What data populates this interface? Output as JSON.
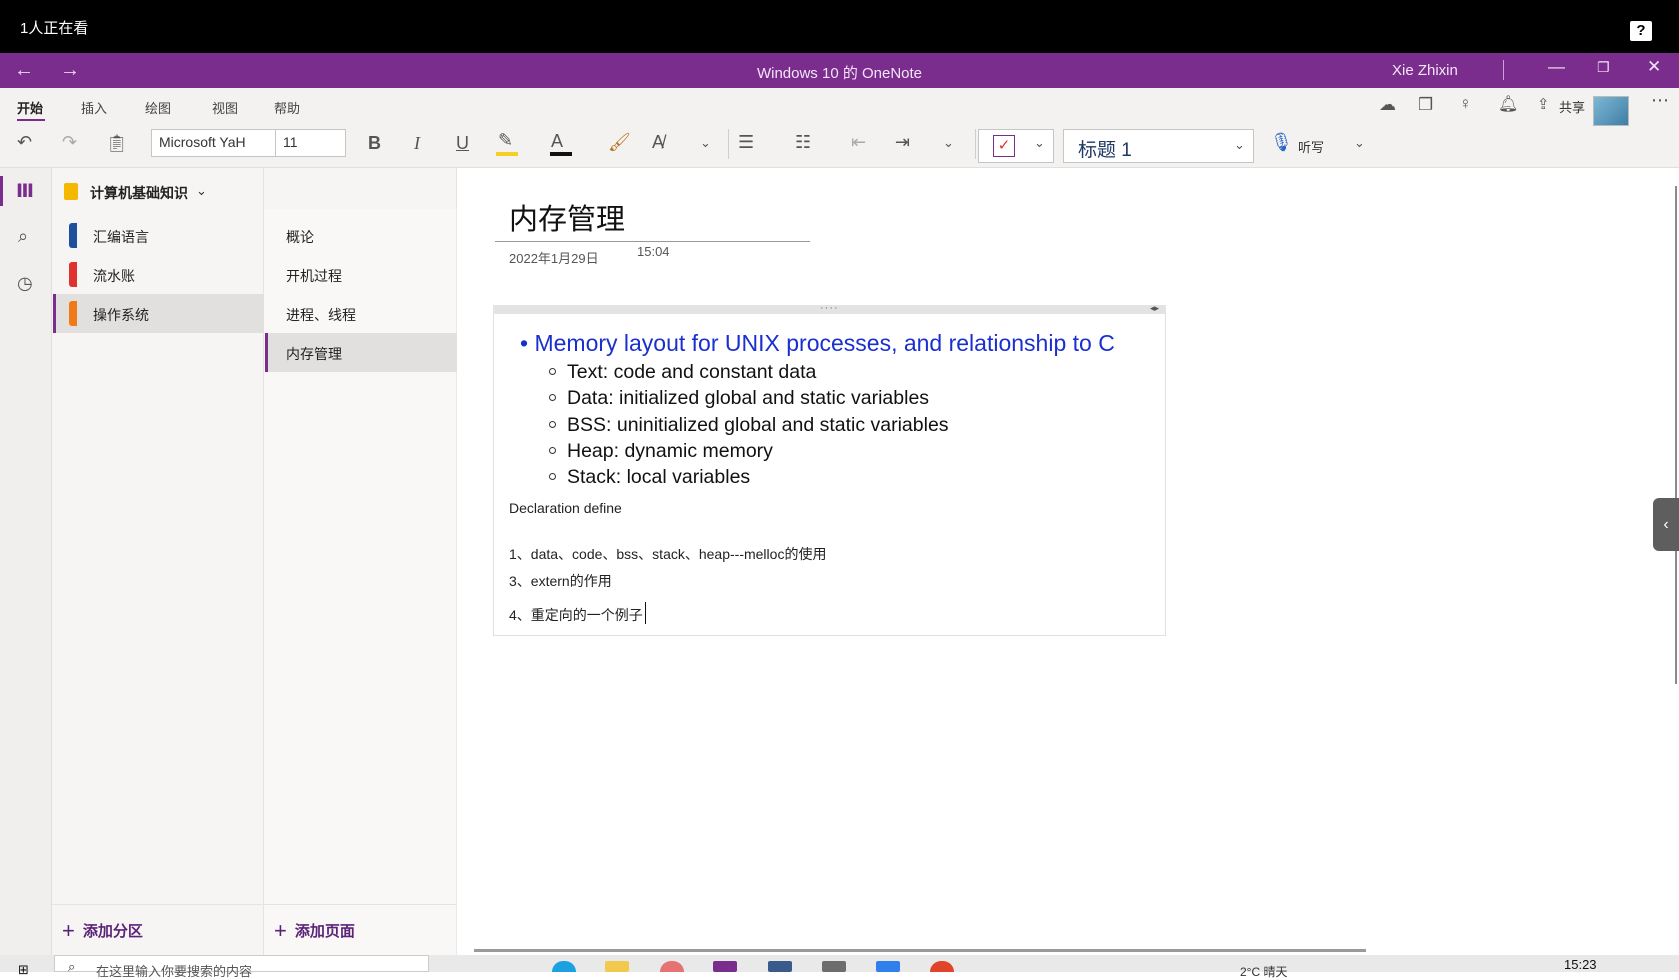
{
  "overlay": {
    "viewer_count": "1人正在看",
    "help_label": "?"
  },
  "titlebar": {
    "title": "Windows 10 的 OneNote",
    "user": "Xie Zhixin"
  },
  "ribbon": {
    "tabs": [
      "开始",
      "插入",
      "绘图",
      "视图",
      "帮助"
    ],
    "font_name": "Microsoft YaH",
    "font_size": "11",
    "style": "标题 1",
    "dictate": "听写",
    "share": "共享"
  },
  "notebook": {
    "name": "计算机基础知识"
  },
  "sections": [
    {
      "label": "汇编语言",
      "color": "#1f4e9c"
    },
    {
      "label": "流水账",
      "color": "#e03131"
    },
    {
      "label": "操作系统",
      "color": "#f07a1a"
    }
  ],
  "pages": [
    "概论",
    "开机过程",
    "进程、线程",
    "内存管理"
  ],
  "buttons": {
    "add_section": "添加分区",
    "add_page": "添加页面"
  },
  "page": {
    "title": "内存管理",
    "date": "2022年1月29日",
    "time": "15:04",
    "bullet_main": "Memory layout for UNIX processes, and relationship to C",
    "sub_bullets": [
      "Text: code and constant data",
      "Data: initialized global and static variables",
      "BSS: uninitialized global and static variables",
      "Heap: dynamic memory",
      "Stack: local variables"
    ],
    "declaration": "Declaration define",
    "lines": [
      "1、data、code、bss、stack、heap---melloc的使用",
      "3、extern的作用",
      "4、重定向的一个例子"
    ]
  },
  "taskbar": {
    "search_placeholder": "在这里输入你要搜索的内容",
    "clock": "15:23",
    "weather": "2°C 晴天"
  },
  "colors": {
    "accent": "#7b2d8e",
    "bullet_blue": "#1a2fd0"
  }
}
